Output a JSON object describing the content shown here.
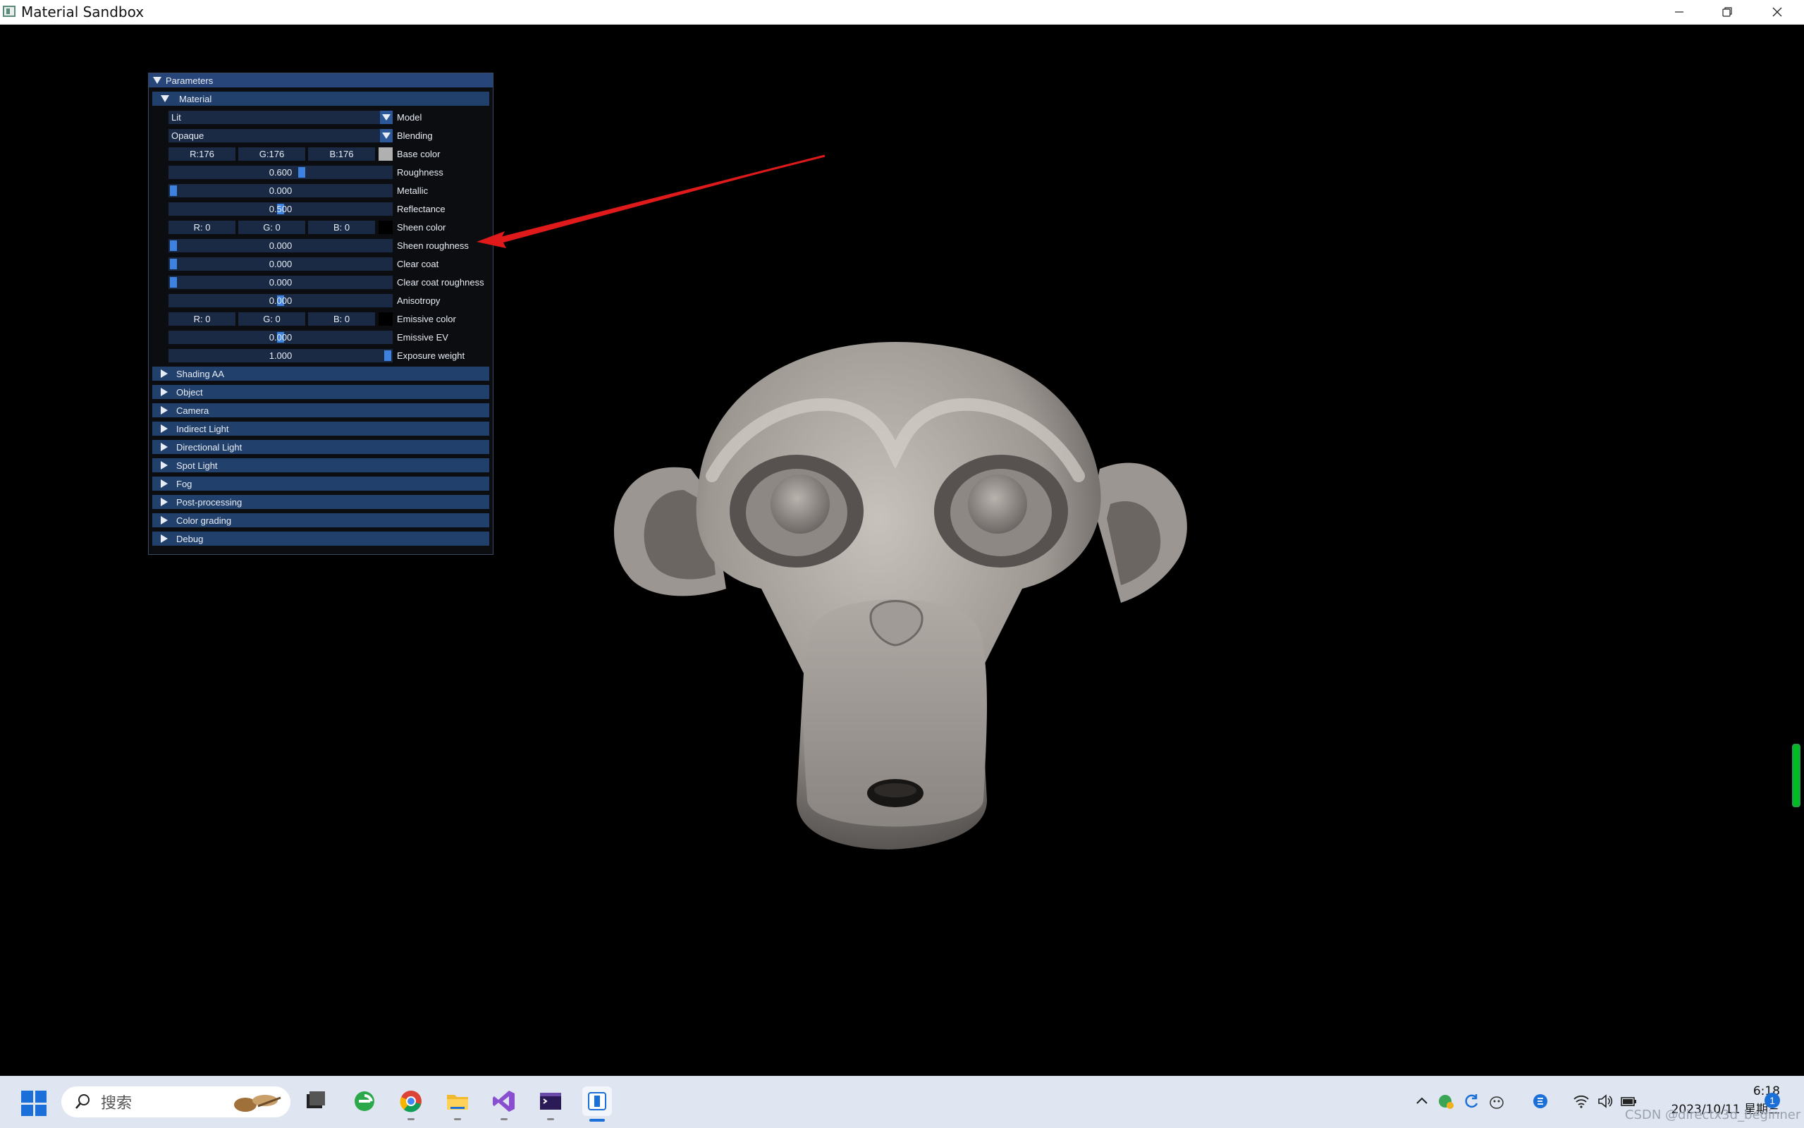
{
  "window": {
    "title": "Material Sandbox"
  },
  "panel": {
    "header": "Parameters",
    "material_section": "Material",
    "model": {
      "value": "Lit",
      "label": "Model"
    },
    "blending": {
      "value": "Opaque",
      "label": "Blending"
    },
    "base_color": {
      "r": "R:176",
      "g": "G:176",
      "b": "B:176",
      "label": "Base color",
      "swatch": "#b0b0b0"
    },
    "roughness": {
      "value": "0.600",
      "level": 0.6,
      "label": "Roughness"
    },
    "metallic": {
      "value": "0.000",
      "level": 0.0,
      "label": "Metallic"
    },
    "reflectance": {
      "value": "0.500",
      "level": 0.5,
      "label": "Reflectance"
    },
    "sheen_color": {
      "r": "R:  0",
      "g": "G:  0",
      "b": "B:  0",
      "label": "Sheen color",
      "swatch": "#000000"
    },
    "sheen_roughness": {
      "value": "0.000",
      "level": 0.0,
      "label": "Sheen roughness"
    },
    "clear_coat": {
      "value": "0.000",
      "level": 0.0,
      "label": "Clear coat"
    },
    "clear_coat_roughness": {
      "value": "0.000",
      "level": 0.0,
      "label": "Clear coat roughness"
    },
    "anisotropy": {
      "value": "0.000",
      "level": 0.5,
      "label": "Anisotropy"
    },
    "emissive_color": {
      "r": "R:  0",
      "g": "G:  0",
      "b": "B:  0",
      "label": "Emissive color",
      "swatch": "#000000"
    },
    "emissive_ev": {
      "value": "0.000",
      "level": 0.5,
      "label": "Emissive EV"
    },
    "exposure_weight": {
      "value": "1.000",
      "level": 1.0,
      "label": "Exposure weight"
    },
    "sections": [
      "Shading AA",
      "Object",
      "Camera",
      "Indirect Light",
      "Directional Light",
      "Spot Light",
      "Fog",
      "Post-processing",
      "Color grading",
      "Debug"
    ]
  },
  "taskbar": {
    "search_placeholder": "搜索",
    "time": "6:18",
    "date": "2023/10/11 星期三",
    "notification_count": "1",
    "watermark": "CSDN @directx3d_beginner",
    "accent": "#1b6fd8"
  },
  "colors": {
    "panel_bg": "#0b0d11",
    "header_bg": "#28457a",
    "section_bg": "#22406c",
    "widget_bg": "#1a2a45",
    "grab": "#3d82e0",
    "annotation_arrow": "#e01a1a"
  }
}
